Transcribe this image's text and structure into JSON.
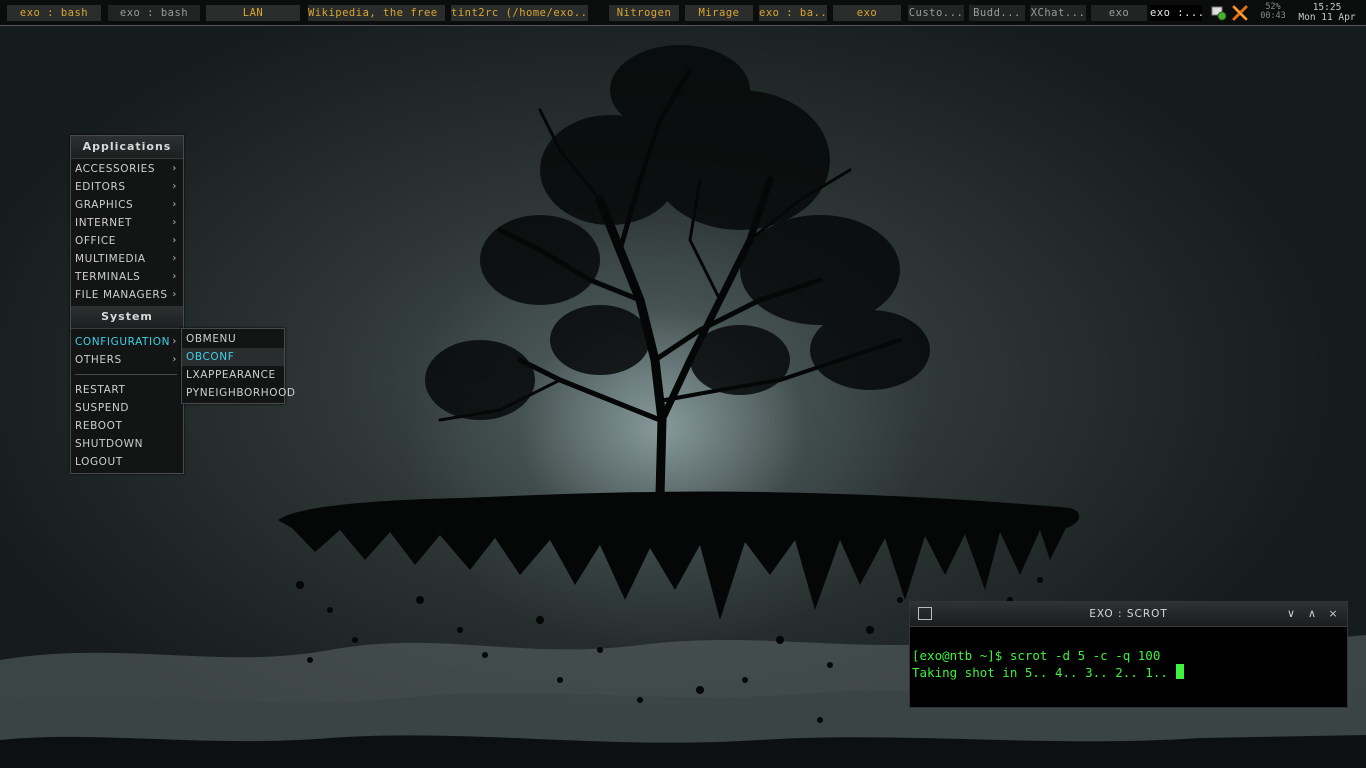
{
  "taskbar": {
    "tasks": [
      {
        "label": "exo : bash",
        "state": "active-app"
      },
      {
        "label": "exo : bash",
        "state": "dim"
      },
      {
        "label": "LAN",
        "state": "normal"
      },
      {
        "label": "Wikipedia, the free ...",
        "state": "normal"
      },
      {
        "label": "tint2rc (/home/exo...",
        "state": "normal"
      },
      {
        "label": "Nitrogen",
        "state": "normal"
      },
      {
        "label": "Mirage",
        "state": "normal"
      },
      {
        "label": "exo : ba...",
        "state": "normal"
      },
      {
        "label": "exo",
        "state": "normal"
      },
      {
        "label": "Custo...",
        "state": "dim"
      },
      {
        "label": "Budd...",
        "state": "dim"
      },
      {
        "label": "XChat...",
        "state": "dim"
      },
      {
        "label": "exo",
        "state": "dim"
      },
      {
        "label": "exo :...",
        "state": "active"
      }
    ],
    "tray": {
      "network_icon": "network-status-icon",
      "tools_icon": "crossed-tools-icon"
    },
    "battery": {
      "percent": "52%",
      "time": "00:43"
    },
    "clock": {
      "time": "15:25",
      "date": "Mon 11 Apr"
    }
  },
  "menu": {
    "applications_title": "Applications",
    "applications": [
      "Accessories",
      "Editors",
      "Graphics",
      "Internet",
      "Office",
      "Multimedia",
      "Terminals",
      "File Managers"
    ],
    "system_title": "System",
    "system_submenus": [
      "Configuration",
      "Others"
    ],
    "actions": [
      "Restart",
      "Suspend",
      "Reboot",
      "Shutdown",
      "Logout"
    ],
    "highlight_color": "#3fd0e6"
  },
  "submenu": {
    "items": [
      "Obmenu",
      "Obconf",
      "LXAppearance",
      "PyNeighborhood"
    ],
    "selected": "Obconf"
  },
  "terminal": {
    "title": "EXO : SCROT",
    "lines": [
      "[exo@ntb ~]$ scrot -d 5 -c -q 100",
      "Taking shot in 5.. 4.. 3.. 2.. 1.. "
    ],
    "text_color": "#3ef23e",
    "buttons": {
      "shade": "∨",
      "maximize": "∧",
      "close": "×"
    }
  }
}
